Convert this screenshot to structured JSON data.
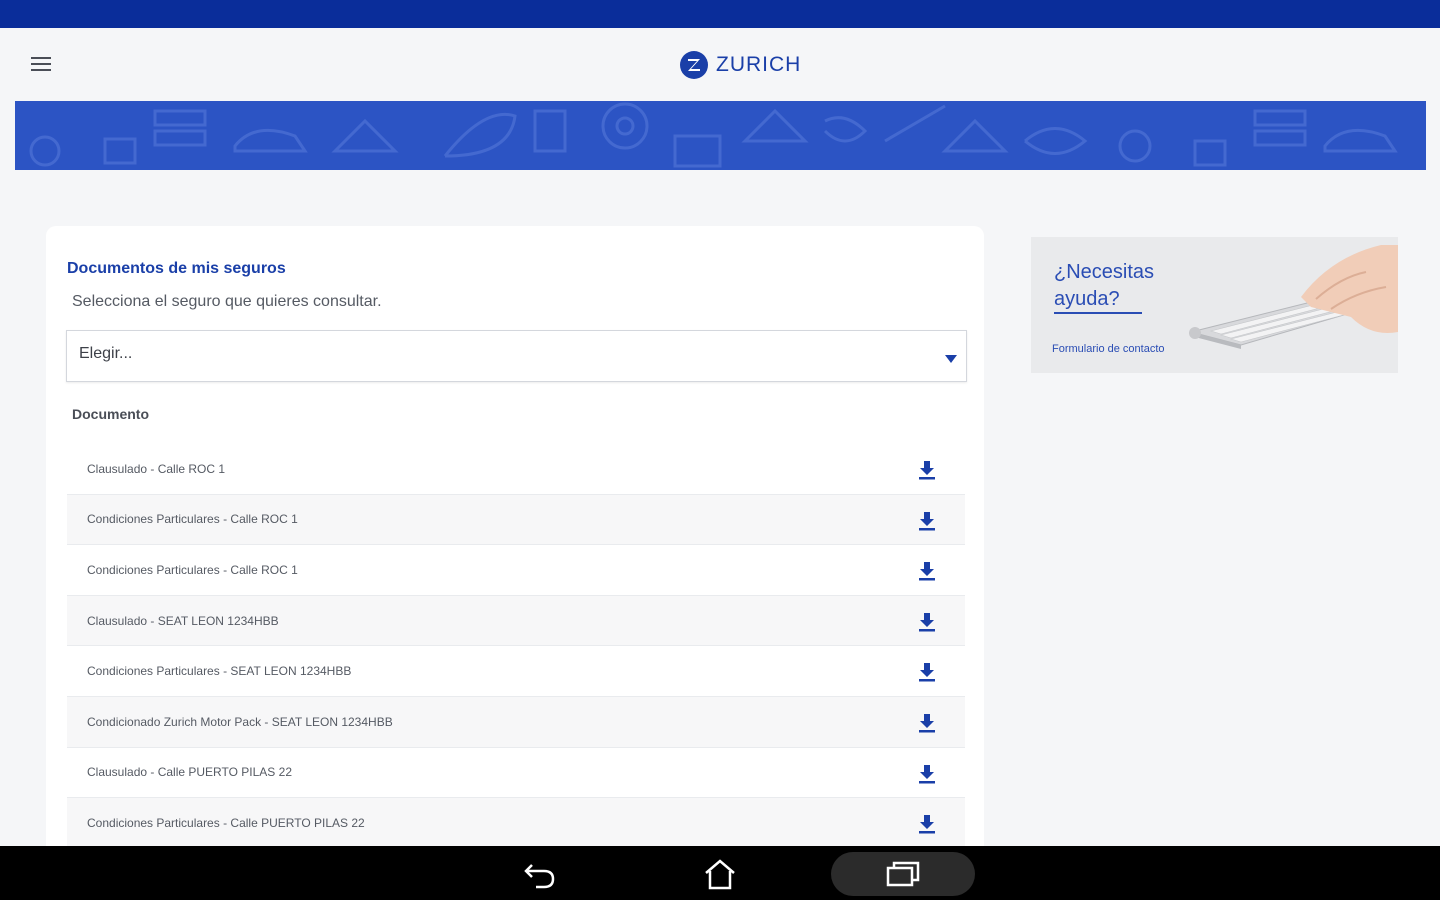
{
  "app": {
    "logo_text": "ZURICH"
  },
  "main": {
    "title": "Documentos de mis seguros",
    "subtitle": "Selecciona el seguro que quieres consultar.",
    "select": {
      "selected": "Elegir..."
    },
    "documents_header": "Documento",
    "documents": [
      {
        "label": "Clausulado - Calle ROC 1"
      },
      {
        "label": "Condiciones Particulares - Calle ROC 1"
      },
      {
        "label": "Condiciones Particulares - Calle ROC 1"
      },
      {
        "label": "Clausulado - SEAT LEON 1234HBB"
      },
      {
        "label": "Condiciones Particulares - SEAT LEON 1234HBB"
      },
      {
        "label": "Condicionado Zurich Motor Pack - SEAT LEON 1234HBB"
      },
      {
        "label": "Clausulado - Calle PUERTO PILAS 22"
      },
      {
        "label": "Condiciones Particulares - Calle PUERTO PILAS 22"
      }
    ]
  },
  "help": {
    "title": "¿Necesitas ayuda?",
    "link": "Formulario de contacto"
  },
  "colors": {
    "brand_blue": "#1a3fa8",
    "status_bar": "#0a2d9a",
    "banner": "#2c54c4"
  },
  "icons": {
    "menu": "hamburger-menu-icon",
    "download": "download-icon",
    "caret": "caret-down-icon",
    "nav_back": "back-icon",
    "nav_home": "home-icon",
    "nav_recents": "recents-icon"
  }
}
